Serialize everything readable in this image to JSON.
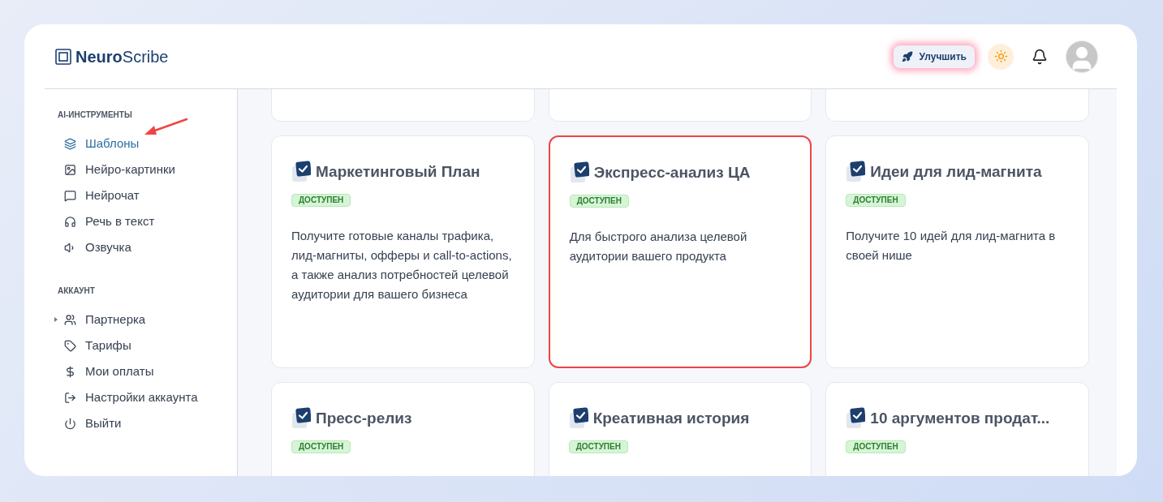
{
  "logo": {
    "bold": "Neuro",
    "regular": "Scribe"
  },
  "header": {
    "upgrade": "Улучшить"
  },
  "sidebar": {
    "sections": [
      {
        "title": "AI-ИНСТРУМЕНТЫ",
        "items": [
          {
            "label": "Шаблоны",
            "selected": true
          },
          {
            "label": "Нейро-картинки",
            "selected": false
          },
          {
            "label": "Нейрочат",
            "selected": false
          },
          {
            "label": "Речь в текст",
            "selected": false
          },
          {
            "label": "Озвучка",
            "selected": false
          }
        ]
      },
      {
        "title": "АККАУНТ",
        "items": [
          {
            "label": "Партнерка",
            "selected": false,
            "expanded": false
          },
          {
            "label": "Тарифы",
            "selected": false
          },
          {
            "label": "Мои оплаты",
            "selected": false
          },
          {
            "label": "Настройки аккаунта",
            "selected": false
          },
          {
            "label": "Выйти",
            "selected": false
          }
        ]
      }
    ]
  },
  "templates": [
    {
      "title": "Маркетинговый План",
      "badge": "ДОСТУПЕН",
      "description": "Получите готовые каналы трафика, лид-магниты, офферы и call-to-actions, а также анализ потребностей целевой аудитории для вашего бизнеса",
      "highlighted": false
    },
    {
      "title": "Экспресс-анализ ЦА",
      "badge": "ДОСТУПЕН",
      "description": "Для быстрого анализа целевой аудитории вашего продукта",
      "highlighted": true
    },
    {
      "title": "Идеи для лид-магнита",
      "badge": "ДОСТУПЕН",
      "description": "Получите 10 идей для лид-магнита в своей нише",
      "highlighted": false
    },
    {
      "title": "Пресс-релиз",
      "badge": "ДОСТУПЕН",
      "highlighted": false
    },
    {
      "title": "Креативная история",
      "badge": "ДОСТУПЕН",
      "highlighted": false
    },
    {
      "title": "10 аргументов продат...",
      "badge": "ДОСТУПЕН",
      "highlighted": false
    }
  ]
}
